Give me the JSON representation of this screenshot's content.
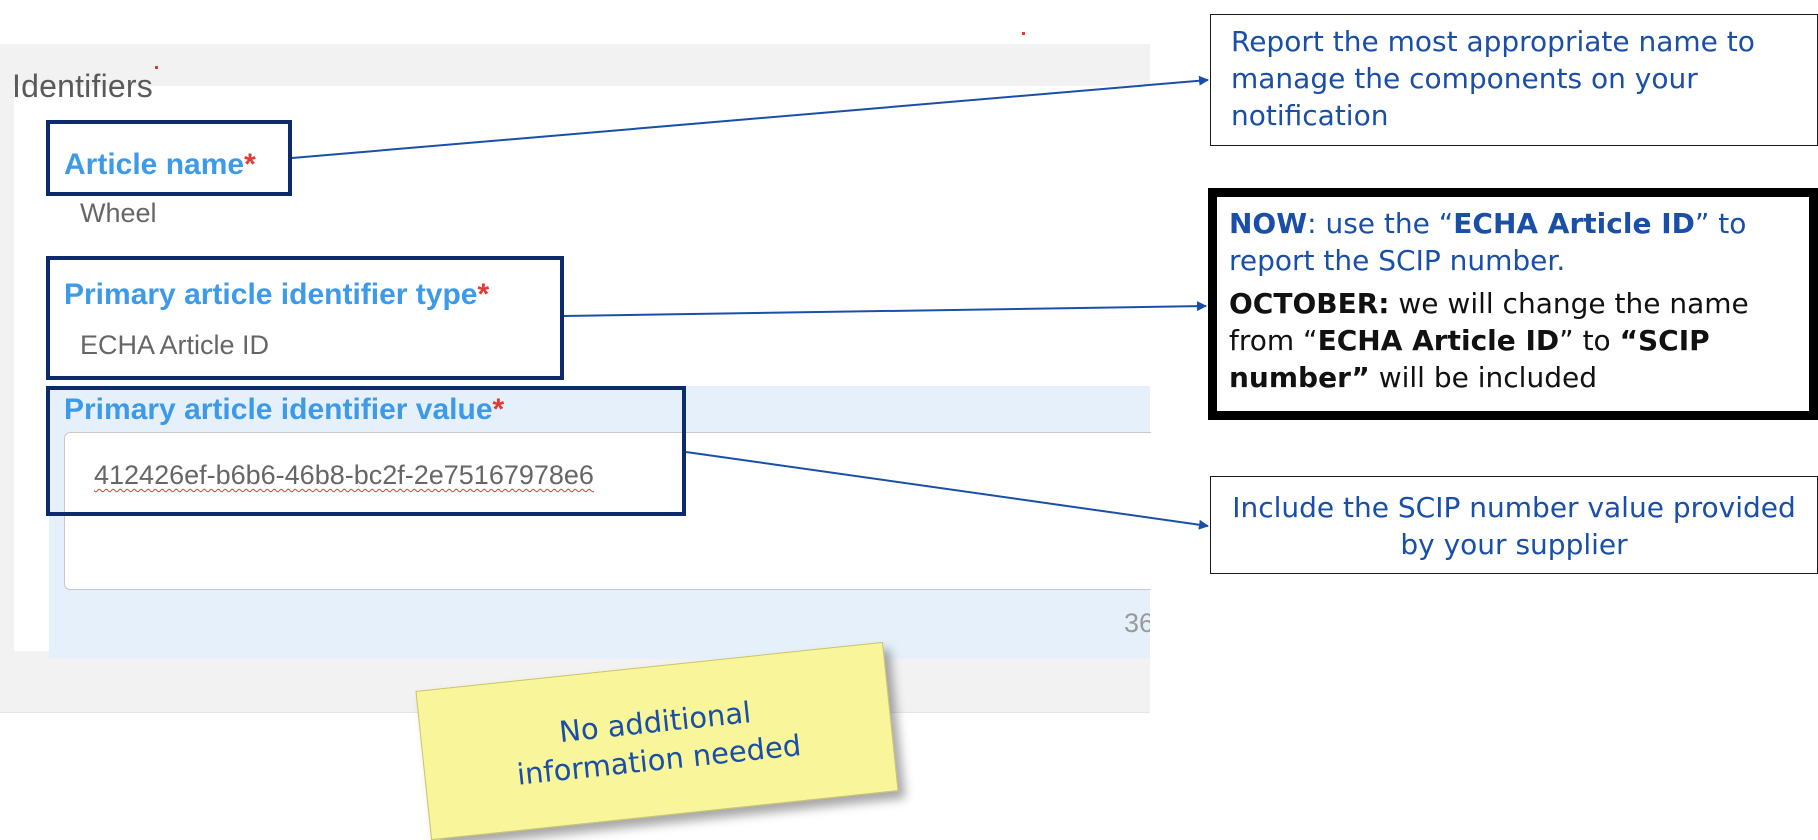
{
  "form": {
    "section_title": "Identifiers",
    "required_marker": "*",
    "article_name": {
      "label": "Article name",
      "value": "Wheel"
    },
    "primary_identifier_type": {
      "label": "Primary article identifier type",
      "value": "ECHA Article ID"
    },
    "primary_identifier_value": {
      "label": "Primary article identifier value",
      "value": "412426ef-b6b6-46b8-bc2f-2e75167978e6",
      "char_count": "36"
    }
  },
  "annotations": {
    "callout_article_name": "Report the most appropriate name to manage the components on your notification",
    "callout_identifier_type": {
      "now_label": "NOW",
      "now_text_1": ": use the “",
      "now_bold": "ECHA Article ID",
      "now_text_2": "” to report the SCIP number.",
      "october_label": "OCTOBER:",
      "october_text_1": " we will change the name from “",
      "october_bold_1": "ECHA Article ID",
      "october_text_2": "”  to ",
      "october_bold_2": "“SCIP number”",
      "october_text_3": " will be included"
    },
    "callout_identifier_value": "Include the SCIP number value provided by your supplier",
    "sticky_note": "No additional information needed"
  },
  "colors": {
    "label_blue": "#3d9ae8",
    "required_red": "#e53935",
    "highlight_navy": "#0d2b6b",
    "annotation_blue": "#1a4fa8",
    "sticky_yellow": "#f8f59a",
    "value_area_bg": "#e6f0fb"
  }
}
